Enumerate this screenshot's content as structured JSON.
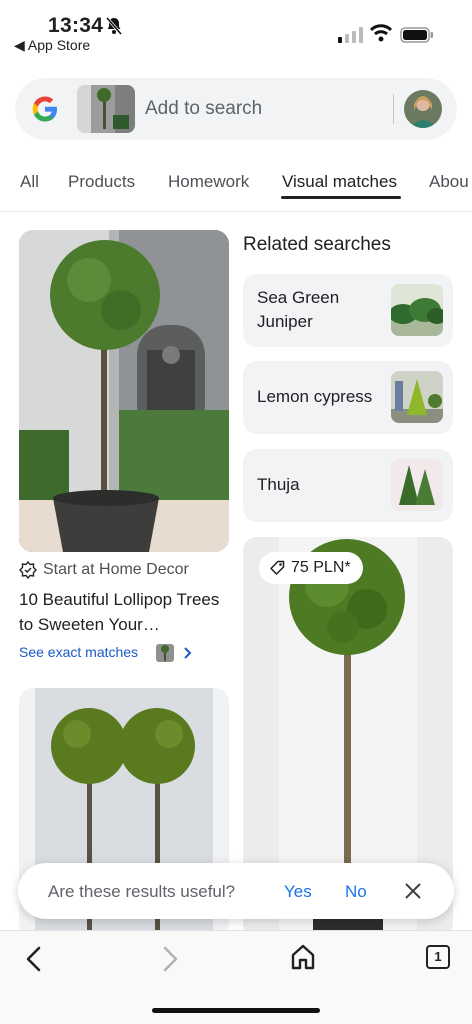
{
  "status_bar": {
    "time": "13:34",
    "back_app_label": "App Store",
    "icons": [
      "bell-slash-icon",
      "signal-icon",
      "wifi-icon",
      "battery-icon"
    ]
  },
  "search": {
    "placeholder": "Add to search",
    "logo": "google-g-icon"
  },
  "tabs": [
    {
      "label": "All"
    },
    {
      "label": "Products"
    },
    {
      "label": "Homework"
    },
    {
      "label": "Visual matches",
      "active": true
    },
    {
      "label": "Abou"
    }
  ],
  "left_column": {
    "result": {
      "source": "Start at Home Decor",
      "title": "10 Beautiful Lollipop Trees to Sweeten Your…",
      "exact_matches": "See exact matches"
    }
  },
  "right_column": {
    "related_heading": "Related searches",
    "related": [
      {
        "label": "Sea Green Juniper"
      },
      {
        "label": "Lemon cypress"
      },
      {
        "label": "Thuja"
      }
    ],
    "product": {
      "price": "75 PLN*"
    }
  },
  "feedback": {
    "question": "Are these results useful?",
    "yes": "Yes",
    "no": "No"
  },
  "toolbar": {
    "tab_count": "1"
  },
  "colors": {
    "accent_blue": "#1a73e8",
    "link_blue": "#1a5ac8",
    "chip_bg": "#f1f3f4"
  }
}
